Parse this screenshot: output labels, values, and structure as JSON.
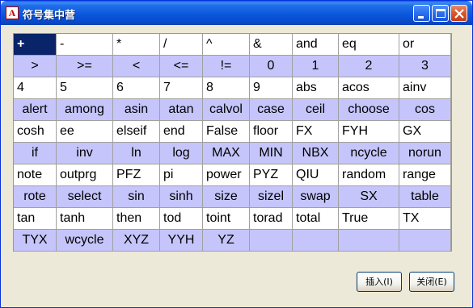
{
  "window": {
    "title": "符号集中营",
    "app_icon_glyph": "A",
    "controls": [
      "minimize",
      "maximize",
      "close"
    ]
  },
  "symbols": [
    [
      "+",
      "-",
      "*",
      "/",
      "^",
      "&",
      "and",
      "eq",
      "or"
    ],
    [
      ">",
      ">=",
      "<",
      "<=",
      "!=",
      "0",
      "1",
      "2",
      "3"
    ],
    [
      "4",
      "5",
      "6",
      "7",
      "8",
      "9",
      "abs",
      "acos",
      "ainv"
    ],
    [
      "alert",
      "among",
      "asin",
      "atan",
      "calvol",
      "case",
      "ceil",
      "choose",
      "cos"
    ],
    [
      "cosh",
      "ee",
      "elseif",
      "end",
      "False",
      "floor",
      "FX",
      "FYH",
      "GX"
    ],
    [
      "if",
      "inv",
      "ln",
      "log",
      "MAX",
      "MIN",
      "NBX",
      "ncycle",
      "norun"
    ],
    [
      "note",
      "outprg",
      "PFZ",
      "pi",
      "power",
      "PYZ",
      "QIU",
      "random",
      "range"
    ],
    [
      "rote",
      "select",
      "sin",
      "sinh",
      "size",
      "sizel",
      "swap",
      "SX",
      "table"
    ],
    [
      "tan",
      "tanh",
      "then",
      "tod",
      "toint",
      "torad",
      "total",
      "True",
      "TX"
    ],
    [
      "TYX",
      "wcycle",
      "XYZ",
      "YYH",
      "YZ",
      "",
      "",
      "",
      ""
    ]
  ],
  "selected_symbol": "+",
  "buttons": {
    "insert": "插入(I)",
    "close": "关闭(E)"
  },
  "colors": {
    "shaded_row": "#c5c5fb",
    "selection": "#0a246a",
    "title_bar": "#0a55dc"
  }
}
